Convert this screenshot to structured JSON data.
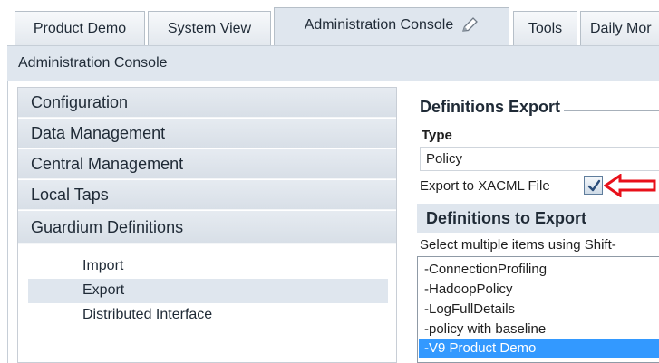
{
  "tabs": [
    {
      "label": "Product Demo"
    },
    {
      "label": "System View"
    },
    {
      "label": "Administration Console",
      "icon": "pencil-icon"
    },
    {
      "label": "Tools"
    },
    {
      "label": "Daily Mor"
    }
  ],
  "header": {
    "title": "Administration Console"
  },
  "nav": {
    "sections": [
      {
        "label": "Configuration"
      },
      {
        "label": "Data Management"
      },
      {
        "label": "Central Management"
      },
      {
        "label": "Local Taps"
      },
      {
        "label": "Guardium Definitions"
      }
    ],
    "sub_items": [
      {
        "label": "Import"
      },
      {
        "label": "Export",
        "selected": true
      },
      {
        "label": "Distributed Interface"
      }
    ]
  },
  "panel": {
    "title": "Definitions Export",
    "type_label": "Type",
    "type_value": "Policy",
    "xacml_label": "Export to XACML File",
    "xacml_checked": true,
    "defs_header": "Definitions to Export",
    "select_hint": "Select multiple items using Shift-",
    "list_items": [
      {
        "label": "-ConnectionProfiling"
      },
      {
        "label": "-HadoopPolicy"
      },
      {
        "label": "-LogFullDetails"
      },
      {
        "label": "-policy with baseline"
      },
      {
        "label": "-V9 Product Demo",
        "selected": true
      }
    ]
  },
  "colors": {
    "tab_active_bg": "#dfe6ee",
    "nav_section_bg": "#dce3ea",
    "selection_bg": "#3399ff",
    "annotation_arrow": "#e8101a"
  }
}
